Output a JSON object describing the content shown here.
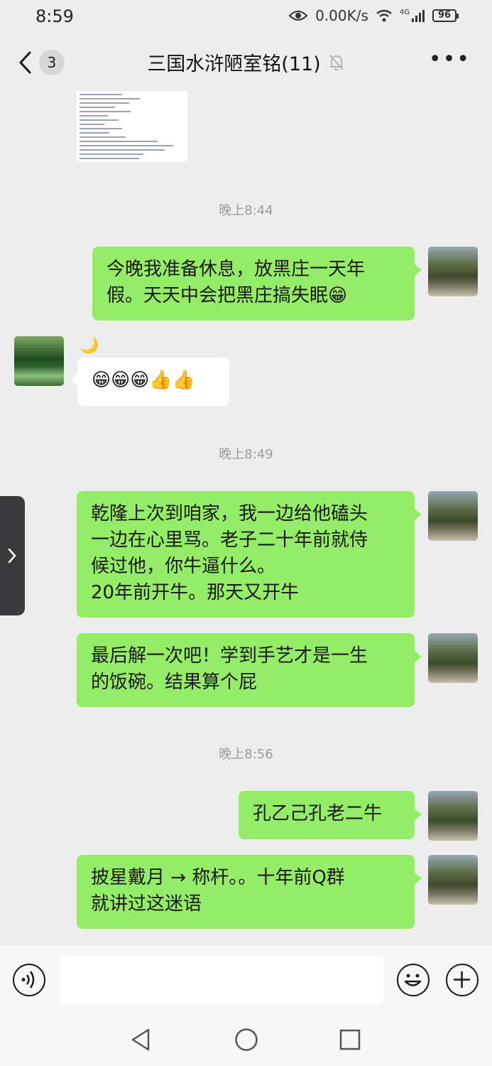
{
  "status_bar": {
    "time": "8:59",
    "network_speed": "0.00K/s",
    "signal_label": "4G",
    "battery": "96"
  },
  "header": {
    "unread_count": "3",
    "title": "三国水浒陋室铭(11)",
    "more_label": "•••"
  },
  "timestamps": [
    "晚上8:44",
    "晚上8:49",
    "晚上8:56"
  ],
  "messages": [
    {
      "sender": "self",
      "text": "今晚我准备休息，放黑庄一天年\n假。天天中会把黑庄搞失眠😁"
    },
    {
      "sender": "other",
      "nickname": "🌙",
      "text": "😁😁😁👍👍"
    },
    {
      "sender": "self",
      "text": "乾隆上次到咱家，我一边给他磕头\n一边在心里骂。老子二十年前就侍\n候过他，你牛逼什么。\n20年前开牛。那天又开牛"
    },
    {
      "sender": "self",
      "text": "最后解一次吧！学到手艺才是一生\n的饭碗。结果算个屁"
    },
    {
      "sender": "self",
      "text": "孔乙己孔老二牛"
    },
    {
      "sender": "self",
      "text": "披星戴月 → 称杆。。十年前Q群\n就讲过这迷语"
    }
  ],
  "icons": {
    "back": "chevron-left-icon",
    "mute": "bell-off-icon",
    "voice": "voice-icon",
    "emoji": "emoji-icon",
    "add": "plus-icon",
    "nav_back": "triangle-back-icon",
    "nav_home": "circle-home-icon",
    "nav_recent": "square-recent-icon"
  },
  "colors": {
    "self_bubble": "#95ec69",
    "other_bubble": "#ffffff",
    "background": "#ededed"
  }
}
